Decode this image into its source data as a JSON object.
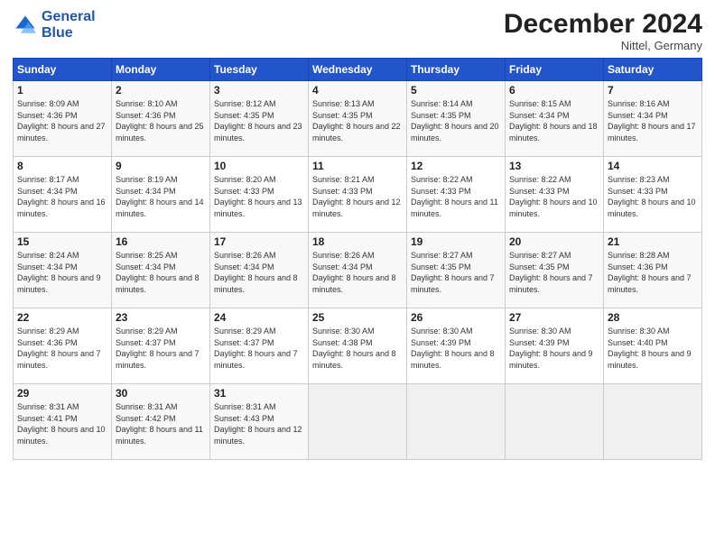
{
  "header": {
    "logo_line1": "General",
    "logo_line2": "Blue",
    "month": "December 2024",
    "location": "Nittel, Germany"
  },
  "weekdays": [
    "Sunday",
    "Monday",
    "Tuesday",
    "Wednesday",
    "Thursday",
    "Friday",
    "Saturday"
  ],
  "weeks": [
    [
      {
        "day": "1",
        "sunrise": "Sunrise: 8:09 AM",
        "sunset": "Sunset: 4:36 PM",
        "daylight": "Daylight: 8 hours and 27 minutes."
      },
      {
        "day": "2",
        "sunrise": "Sunrise: 8:10 AM",
        "sunset": "Sunset: 4:36 PM",
        "daylight": "Daylight: 8 hours and 25 minutes."
      },
      {
        "day": "3",
        "sunrise": "Sunrise: 8:12 AM",
        "sunset": "Sunset: 4:35 PM",
        "daylight": "Daylight: 8 hours and 23 minutes."
      },
      {
        "day": "4",
        "sunrise": "Sunrise: 8:13 AM",
        "sunset": "Sunset: 4:35 PM",
        "daylight": "Daylight: 8 hours and 22 minutes."
      },
      {
        "day": "5",
        "sunrise": "Sunrise: 8:14 AM",
        "sunset": "Sunset: 4:35 PM",
        "daylight": "Daylight: 8 hours and 20 minutes."
      },
      {
        "day": "6",
        "sunrise": "Sunrise: 8:15 AM",
        "sunset": "Sunset: 4:34 PM",
        "daylight": "Daylight: 8 hours and 18 minutes."
      },
      {
        "day": "7",
        "sunrise": "Sunrise: 8:16 AM",
        "sunset": "Sunset: 4:34 PM",
        "daylight": "Daylight: 8 hours and 17 minutes."
      }
    ],
    [
      {
        "day": "8",
        "sunrise": "Sunrise: 8:17 AM",
        "sunset": "Sunset: 4:34 PM",
        "daylight": "Daylight: 8 hours and 16 minutes."
      },
      {
        "day": "9",
        "sunrise": "Sunrise: 8:19 AM",
        "sunset": "Sunset: 4:34 PM",
        "daylight": "Daylight: 8 hours and 14 minutes."
      },
      {
        "day": "10",
        "sunrise": "Sunrise: 8:20 AM",
        "sunset": "Sunset: 4:33 PM",
        "daylight": "Daylight: 8 hours and 13 minutes."
      },
      {
        "day": "11",
        "sunrise": "Sunrise: 8:21 AM",
        "sunset": "Sunset: 4:33 PM",
        "daylight": "Daylight: 8 hours and 12 minutes."
      },
      {
        "day": "12",
        "sunrise": "Sunrise: 8:22 AM",
        "sunset": "Sunset: 4:33 PM",
        "daylight": "Daylight: 8 hours and 11 minutes."
      },
      {
        "day": "13",
        "sunrise": "Sunrise: 8:22 AM",
        "sunset": "Sunset: 4:33 PM",
        "daylight": "Daylight: 8 hours and 10 minutes."
      },
      {
        "day": "14",
        "sunrise": "Sunrise: 8:23 AM",
        "sunset": "Sunset: 4:33 PM",
        "daylight": "Daylight: 8 hours and 10 minutes."
      }
    ],
    [
      {
        "day": "15",
        "sunrise": "Sunrise: 8:24 AM",
        "sunset": "Sunset: 4:34 PM",
        "daylight": "Daylight: 8 hours and 9 minutes."
      },
      {
        "day": "16",
        "sunrise": "Sunrise: 8:25 AM",
        "sunset": "Sunset: 4:34 PM",
        "daylight": "Daylight: 8 hours and 8 minutes."
      },
      {
        "day": "17",
        "sunrise": "Sunrise: 8:26 AM",
        "sunset": "Sunset: 4:34 PM",
        "daylight": "Daylight: 8 hours and 8 minutes."
      },
      {
        "day": "18",
        "sunrise": "Sunrise: 8:26 AM",
        "sunset": "Sunset: 4:34 PM",
        "daylight": "Daylight: 8 hours and 8 minutes."
      },
      {
        "day": "19",
        "sunrise": "Sunrise: 8:27 AM",
        "sunset": "Sunset: 4:35 PM",
        "daylight": "Daylight: 8 hours and 7 minutes."
      },
      {
        "day": "20",
        "sunrise": "Sunrise: 8:27 AM",
        "sunset": "Sunset: 4:35 PM",
        "daylight": "Daylight: 8 hours and 7 minutes."
      },
      {
        "day": "21",
        "sunrise": "Sunrise: 8:28 AM",
        "sunset": "Sunset: 4:36 PM",
        "daylight": "Daylight: 8 hours and 7 minutes."
      }
    ],
    [
      {
        "day": "22",
        "sunrise": "Sunrise: 8:29 AM",
        "sunset": "Sunset: 4:36 PM",
        "daylight": "Daylight: 8 hours and 7 minutes."
      },
      {
        "day": "23",
        "sunrise": "Sunrise: 8:29 AM",
        "sunset": "Sunset: 4:37 PM",
        "daylight": "Daylight: 8 hours and 7 minutes."
      },
      {
        "day": "24",
        "sunrise": "Sunrise: 8:29 AM",
        "sunset": "Sunset: 4:37 PM",
        "daylight": "Daylight: 8 hours and 7 minutes."
      },
      {
        "day": "25",
        "sunrise": "Sunrise: 8:30 AM",
        "sunset": "Sunset: 4:38 PM",
        "daylight": "Daylight: 8 hours and 8 minutes."
      },
      {
        "day": "26",
        "sunrise": "Sunrise: 8:30 AM",
        "sunset": "Sunset: 4:39 PM",
        "daylight": "Daylight: 8 hours and 8 minutes."
      },
      {
        "day": "27",
        "sunrise": "Sunrise: 8:30 AM",
        "sunset": "Sunset: 4:39 PM",
        "daylight": "Daylight: 8 hours and 9 minutes."
      },
      {
        "day": "28",
        "sunrise": "Sunrise: 8:30 AM",
        "sunset": "Sunset: 4:40 PM",
        "daylight": "Daylight: 8 hours and 9 minutes."
      }
    ],
    [
      {
        "day": "29",
        "sunrise": "Sunrise: 8:31 AM",
        "sunset": "Sunset: 4:41 PM",
        "daylight": "Daylight: 8 hours and 10 minutes."
      },
      {
        "day": "30",
        "sunrise": "Sunrise: 8:31 AM",
        "sunset": "Sunset: 4:42 PM",
        "daylight": "Daylight: 8 hours and 11 minutes."
      },
      {
        "day": "31",
        "sunrise": "Sunrise: 8:31 AM",
        "sunset": "Sunset: 4:43 PM",
        "daylight": "Daylight: 8 hours and 12 minutes."
      },
      null,
      null,
      null,
      null
    ]
  ]
}
